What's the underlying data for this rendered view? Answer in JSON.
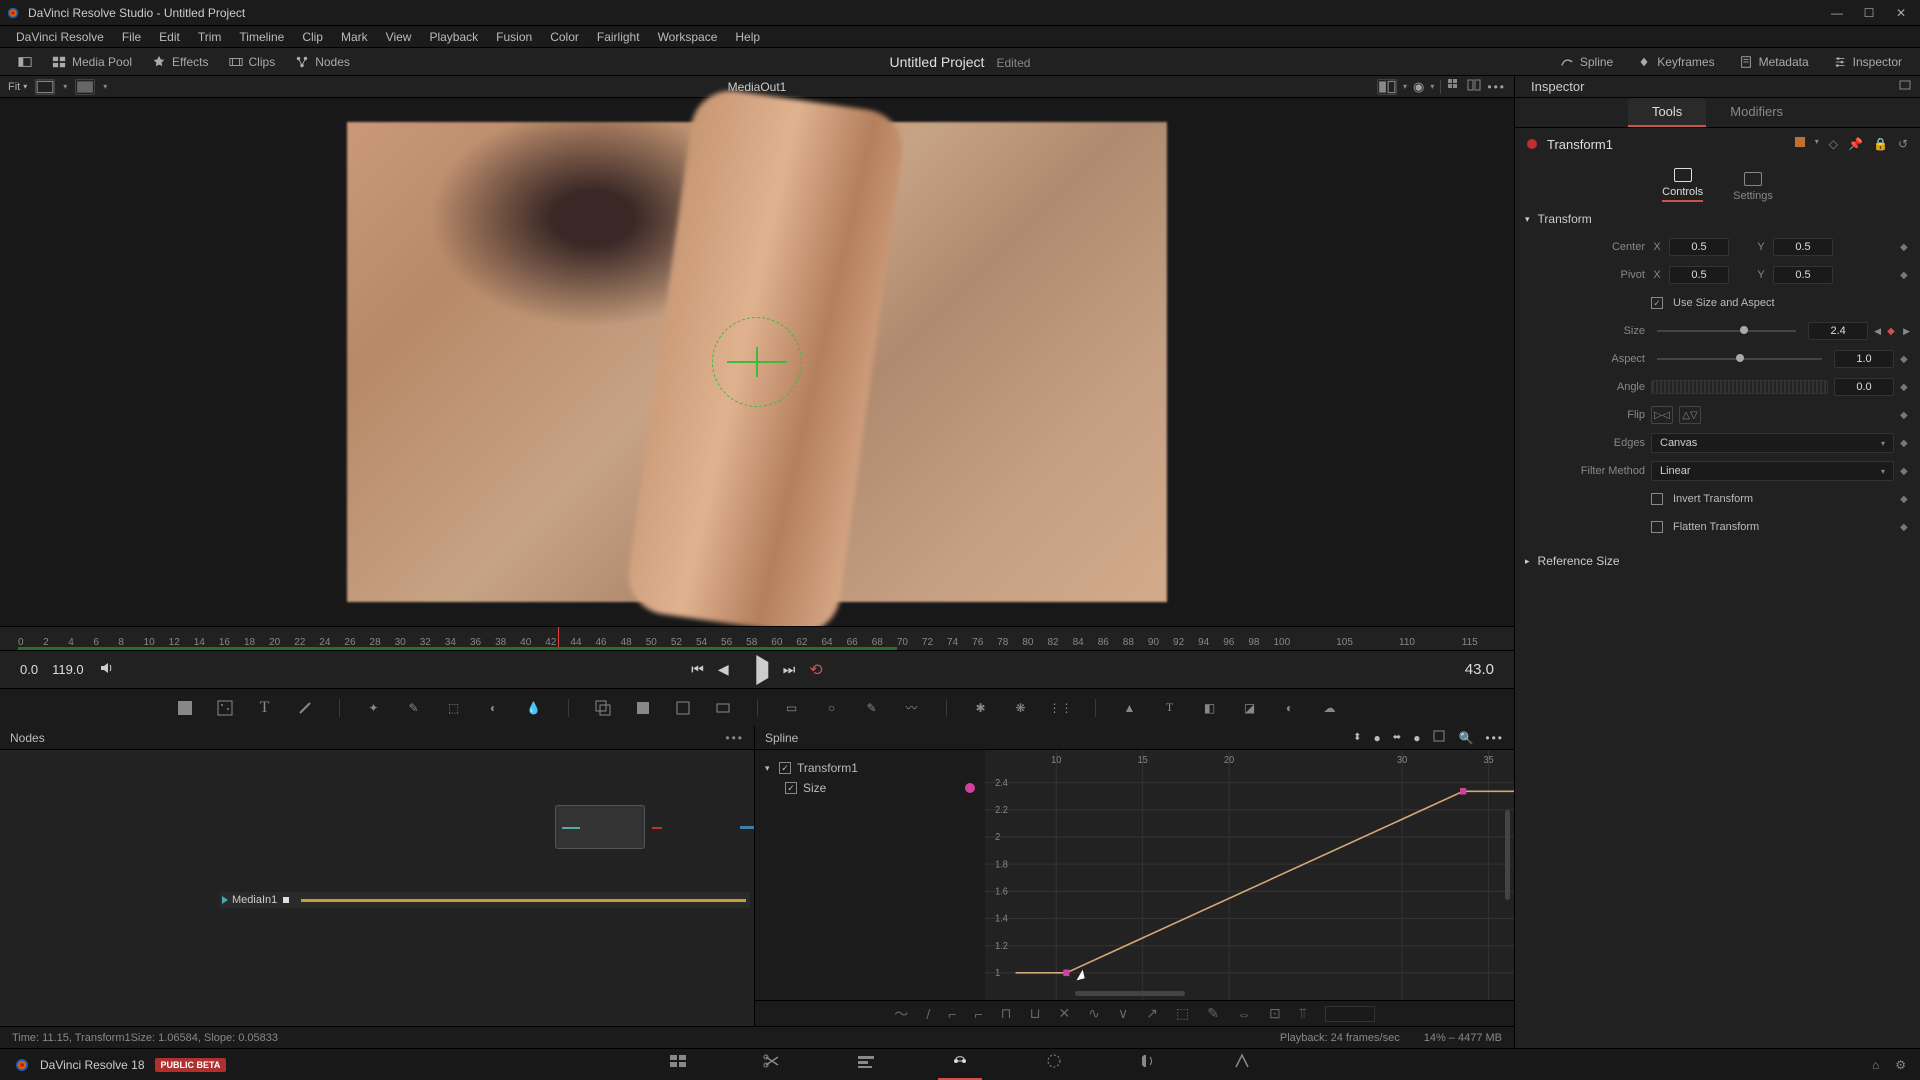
{
  "window": {
    "title": "DaVinci Resolve Studio - Untitled Project"
  },
  "menubar": [
    "DaVinci Resolve",
    "File",
    "Edit",
    "Trim",
    "Timeline",
    "Clip",
    "Mark",
    "View",
    "Playback",
    "Fusion",
    "Color",
    "Fairlight",
    "Workspace",
    "Help"
  ],
  "top_toolbar": {
    "left": [
      {
        "icon": "media-pool-icon",
        "label": "Media Pool"
      },
      {
        "icon": "effects-icon",
        "label": "Effects"
      },
      {
        "icon": "clips-icon",
        "label": "Clips"
      },
      {
        "icon": "nodes-icon",
        "label": "Nodes"
      }
    ],
    "project_title": "Untitled Project",
    "edited": "Edited",
    "right": [
      {
        "icon": "spline-icon",
        "label": "Spline"
      },
      {
        "icon": "keyframes-icon",
        "label": "Keyframes"
      },
      {
        "icon": "metadata-icon",
        "label": "Metadata"
      },
      {
        "icon": "inspector-icon",
        "label": "Inspector"
      }
    ]
  },
  "secbar": {
    "fit": "Fit",
    "viewer_title": "MediaOut1",
    "inspector_label": "Inspector"
  },
  "ruler": {
    "ticks": [
      "0",
      "2",
      "4",
      "6",
      "8",
      "10",
      "12",
      "14",
      "16",
      "18",
      "20",
      "22",
      "24",
      "26",
      "28",
      "30",
      "32",
      "34",
      "36",
      "38",
      "40",
      "42",
      "44",
      "46",
      "48",
      "50",
      "52",
      "54",
      "56",
      "58",
      "60",
      "62",
      "64",
      "66",
      "68",
      "70",
      "72",
      "74",
      "76",
      "78",
      "80",
      "82",
      "84",
      "86",
      "88",
      "90",
      "92",
      "94",
      "96",
      "98",
      "100",
      "105",
      "110",
      "115"
    ],
    "playhead": 43
  },
  "transport": {
    "start_tc": "0.0",
    "end_tc": "119.0",
    "current_frame": "43.0"
  },
  "nodes_panel": {
    "title": "Nodes",
    "mediain_label": "MediaIn1"
  },
  "spline_panel": {
    "title": "Spline",
    "tree": {
      "node": "Transform1",
      "param": "Size"
    },
    "y_ticks": [
      "2.4",
      "2.2",
      "2",
      "1.8",
      "1.6",
      "1.4",
      "1.2",
      "1"
    ],
    "x_ticks": [
      "10",
      "15",
      "20",
      "30",
      "35"
    ]
  },
  "status": {
    "left": "Time: 11.15,    Transform1Size:    1.06584,    Slope: 0.05833",
    "playback": "Playback: 24 frames/sec",
    "mem": "14% – 4477 MB"
  },
  "bottom": {
    "app": "DaVinci Resolve 18",
    "badge": "PUBLIC BETA"
  },
  "inspector": {
    "tabs": {
      "tools": "Tools",
      "modifiers": "Modifiers"
    },
    "node_name": "Transform1",
    "subtabs": {
      "controls": "Controls",
      "settings": "Settings"
    },
    "section_transform": "Transform",
    "section_refsize": "Reference Size",
    "params": {
      "center_label": "Center",
      "center_x": "0.5",
      "center_y": "0.5",
      "pivot_label": "Pivot",
      "pivot_x": "0.5",
      "pivot_y": "0.5",
      "use_size_label": "Use Size and Aspect",
      "size_label": "Size",
      "size_val": "2.4",
      "aspect_label": "Aspect",
      "aspect_val": "1.0",
      "angle_label": "Angle",
      "angle_val": "0.0",
      "flip_label": "Flip",
      "edges_label": "Edges",
      "edges_val": "Canvas",
      "filter_label": "Filter Method",
      "filter_val": "Linear",
      "invert_label": "Invert Transform",
      "flatten_label": "Flatten Transform"
    }
  }
}
